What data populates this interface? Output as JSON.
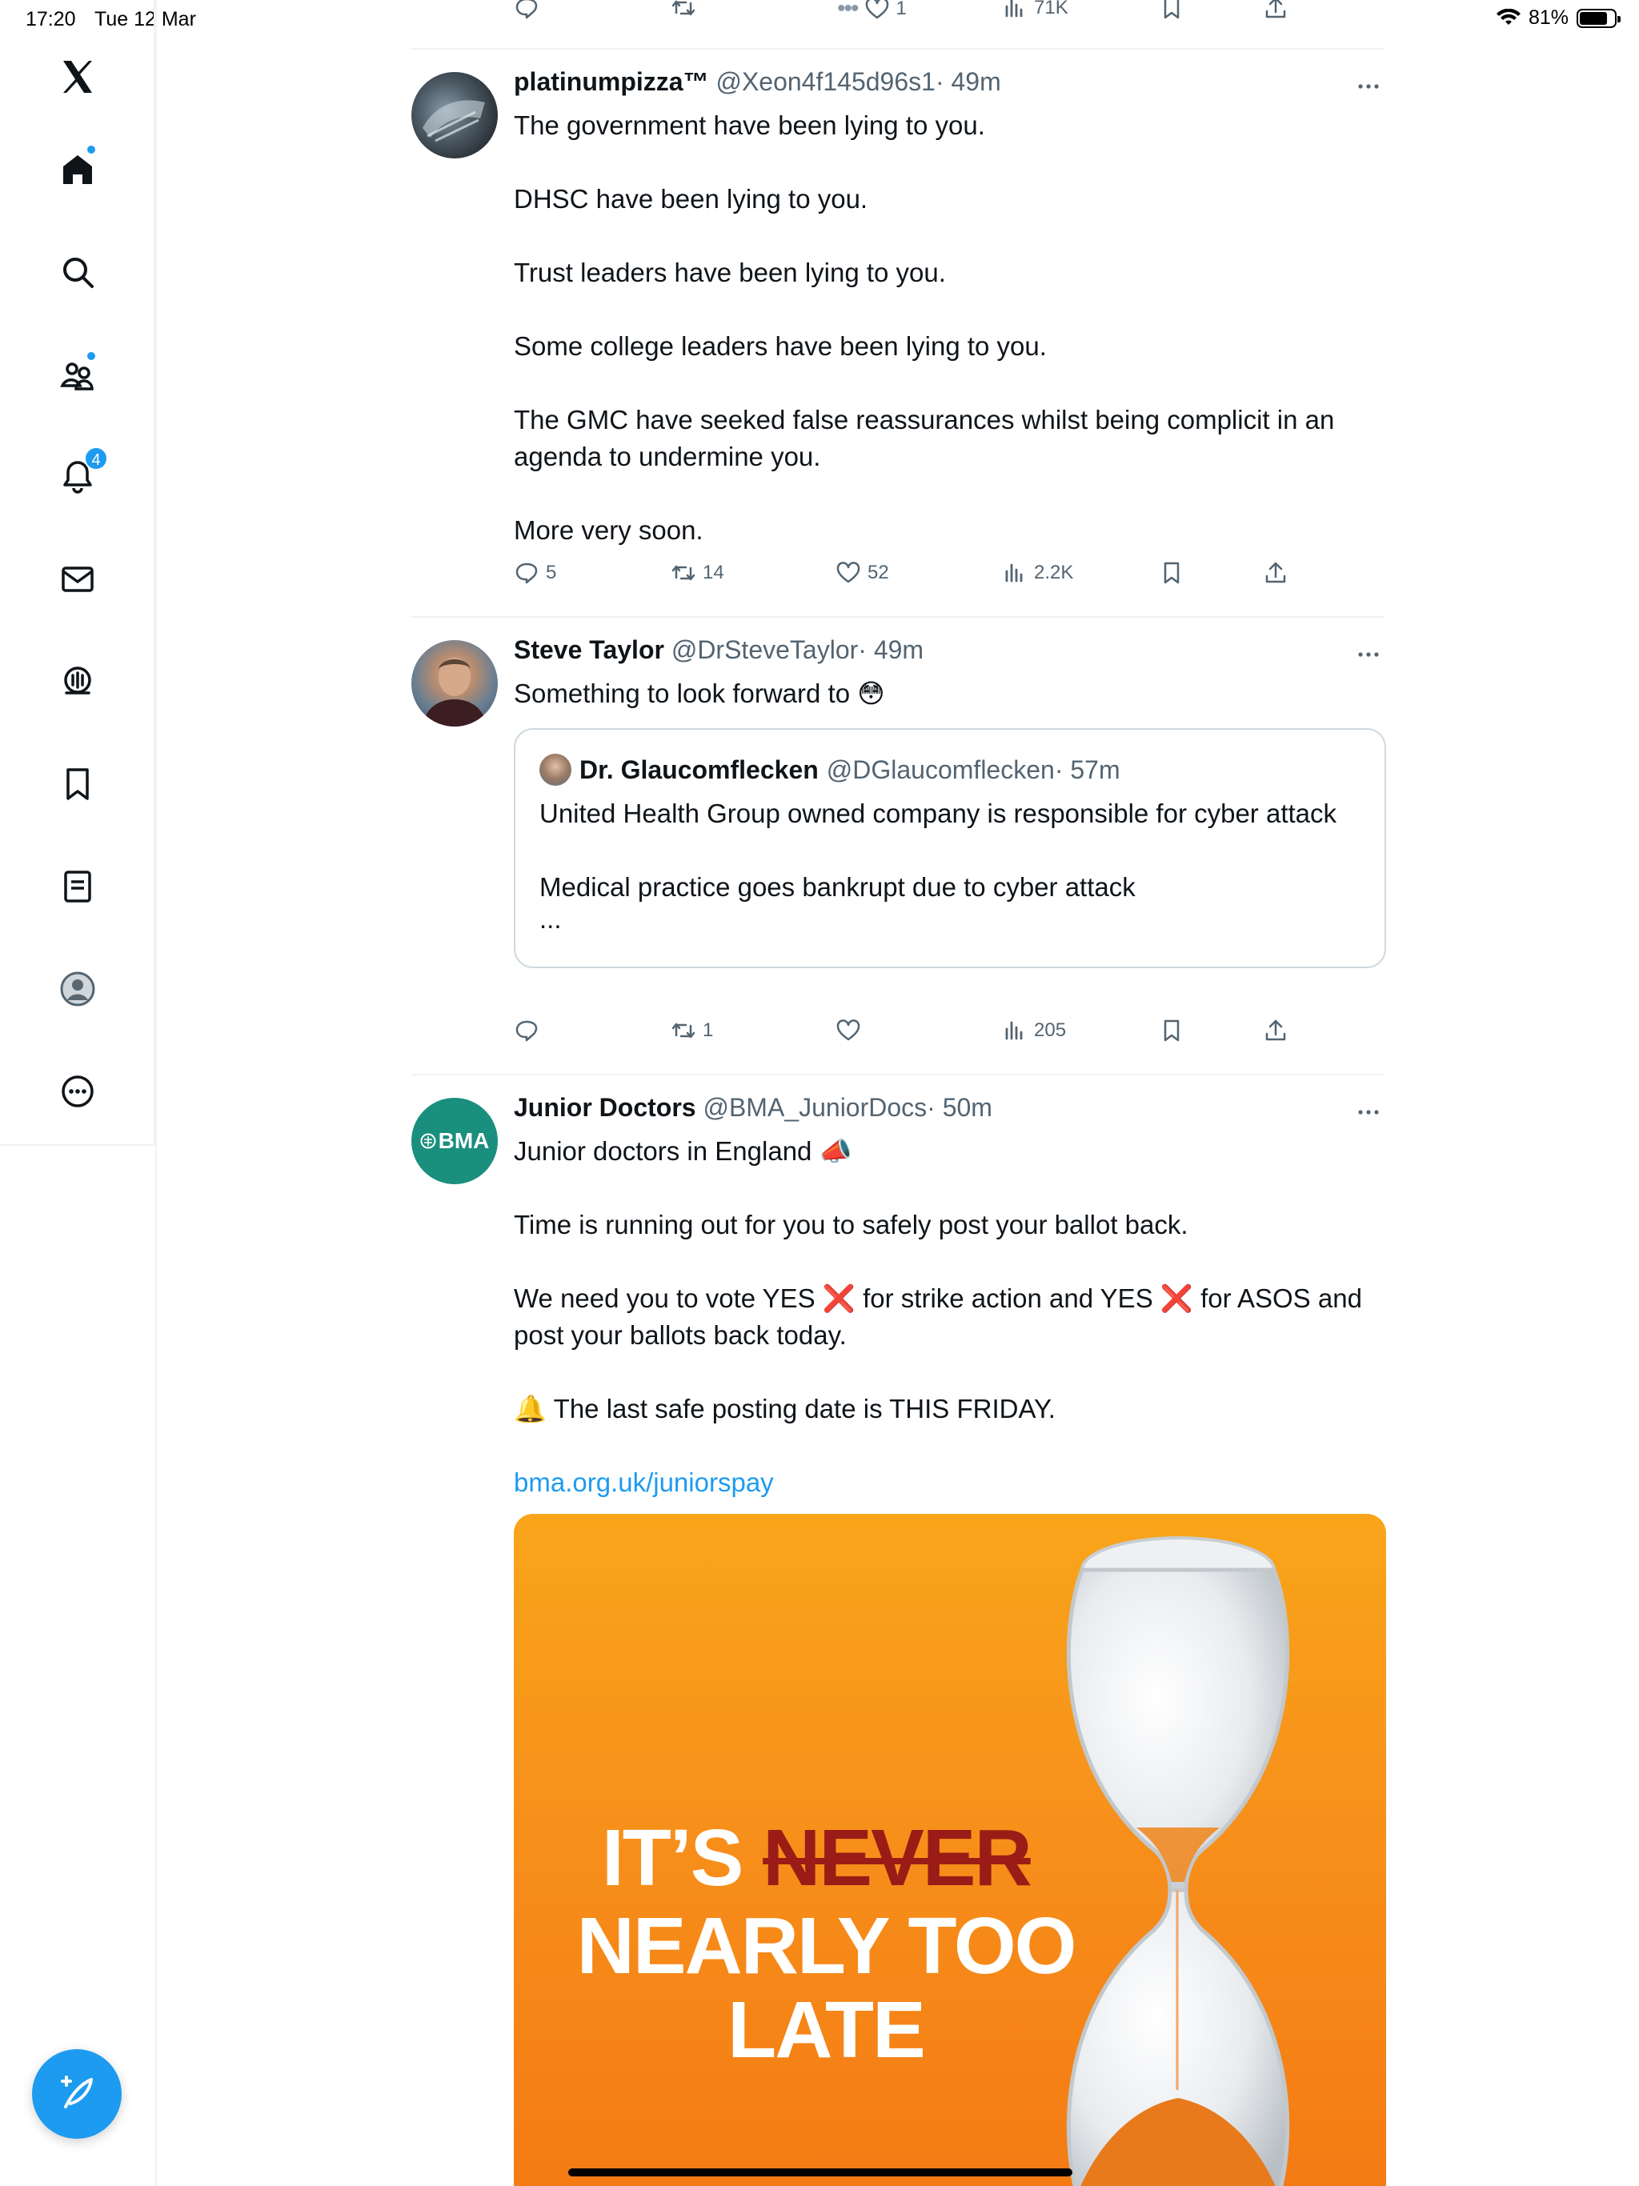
{
  "status_bar": {
    "time": "17:20",
    "date": "Tue 12 Mar",
    "battery": "81%",
    "battery_level": 0.81
  },
  "sidebar": {
    "items": [
      {
        "name": "home",
        "label": "Home"
      },
      {
        "name": "explore",
        "label": "Explore"
      },
      {
        "name": "communities",
        "label": "Communities"
      },
      {
        "name": "notifications",
        "label": "Notifications",
        "badge": "4"
      },
      {
        "name": "messages",
        "label": "Messages"
      },
      {
        "name": "spaces",
        "label": "Spaces"
      },
      {
        "name": "bookmarks",
        "label": "Bookmarks"
      },
      {
        "name": "lists",
        "label": "Lists"
      },
      {
        "name": "profile",
        "label": "Profile"
      },
      {
        "name": "more",
        "label": "More"
      }
    ]
  },
  "top_actions": {
    "replies": "",
    "retweets": "",
    "likes": "1",
    "views": "71K"
  },
  "tweets": [
    {
      "name": "platinumpizza™",
      "handle": "@Xeon4f145d96s1",
      "time": "· 49m",
      "paragraphs": [
        "The government have been lying to you.",
        "DHSC have been lying to you.",
        "Trust leaders have been lying to you.",
        "Some college leaders have been lying to you.",
        "The GMC have seeked false reassurances whilst being complicit in an agenda to undermine you.",
        "More very soon."
      ],
      "replies": "5",
      "retweets": "14",
      "likes": "52",
      "views": "2.2K"
    },
    {
      "name": "Steve Taylor",
      "handle": "@DrSteveTaylor",
      "time": "· 49m",
      "text": "Something to look forward to 😳",
      "quote": {
        "name": "Dr. Glaucomflecken",
        "handle": "@DGlaucomflecken",
        "time": "· 57m",
        "paragraphs": [
          "United Health Group owned company is responsible for cyber attack",
          "Medical practice goes bankrupt due to cyber attack",
          "..."
        ]
      },
      "replies": "",
      "retweets": "1",
      "likes": "",
      "views": "205"
    },
    {
      "name": "Junior Doctors",
      "handle": "@BMA_JuniorDocs",
      "time": "· 50m",
      "avatar_text": "BMA",
      "paragraphs": [
        "Junior doctors in England 📣",
        "Time is running out for you to safely post your ballot back.",
        "We need you to vote YES ❌ for strike action and YES ❌ for ASOS and post your ballots back today.",
        "🔔 The last safe posting date is THIS FRIDAY."
      ],
      "link": "bma.org.uk/juniorspay",
      "poster": {
        "line1_a": "IT’S",
        "line1_b": "NEVER",
        "line2": "NEARLY TOO",
        "line3": "LATE"
      }
    }
  ],
  "colors": {
    "accent": "#1d9bf0",
    "text": "#0f1419",
    "muted": "#536471",
    "bma_green": "#1a8f7e",
    "poster_orange": "#f7901b"
  }
}
